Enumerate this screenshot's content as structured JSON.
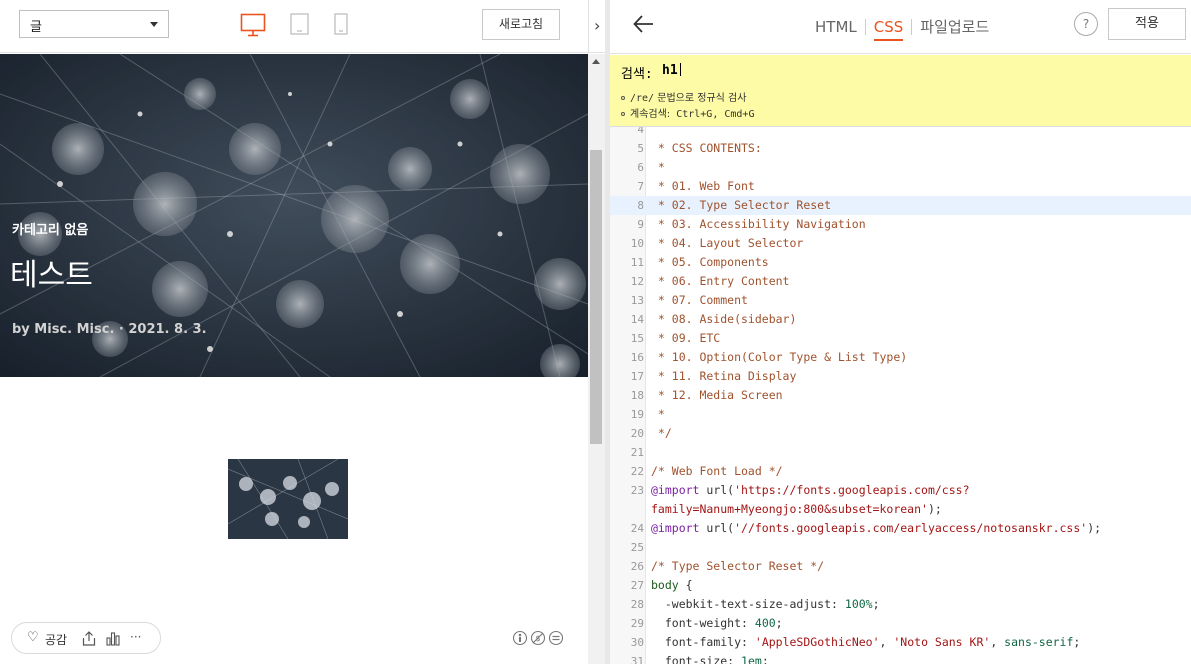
{
  "left": {
    "select_value": "글",
    "refresh_label": "새로고침",
    "hero": {
      "category": "카테고리 없음",
      "title": "테스트",
      "meta": "by Misc. Misc.  ·  2021. 8. 3."
    },
    "reaction": {
      "like_label": "공감",
      "more_label": "···"
    }
  },
  "editor": {
    "tabs": [
      {
        "label": "HTML",
        "active": false
      },
      {
        "label": "CSS",
        "active": true
      },
      {
        "label": "파일업로드",
        "active": false
      }
    ],
    "help_label": "?",
    "apply_label": "적용",
    "search": {
      "label": "검색:",
      "value": "h1",
      "hint1_a": "/re/",
      "hint1_b": " 문법으로 정규식 검사",
      "hint2_a": "계속검색:",
      "hint2_b": " Ctrl+G, Cmd+G"
    },
    "code_lines": [
      {
        "n": "4",
        "t": ""
      },
      {
        "n": "5",
        "t": " * CSS CONTENTS:",
        "cls": "c-com"
      },
      {
        "n": "6",
        "t": " *",
        "cls": "c-com"
      },
      {
        "n": "7",
        "t": " * 01. Web Font",
        "cls": "c-com"
      },
      {
        "n": "8",
        "t": " * 02. Type Selector Reset",
        "cls": "c-com",
        "hl": true
      },
      {
        "n": "9",
        "t": " * 03. Accessibility Navigation",
        "cls": "c-com"
      },
      {
        "n": "10",
        "t": " * 04. Layout Selector",
        "cls": "c-com"
      },
      {
        "n": "11",
        "t": " * 05. Components",
        "cls": "c-com"
      },
      {
        "n": "12",
        "t": " * 06. Entry Content",
        "cls": "c-com"
      },
      {
        "n": "13",
        "t": " * 07. Comment",
        "cls": "c-com"
      },
      {
        "n": "14",
        "t": " * 08. Aside(sidebar)",
        "cls": "c-com"
      },
      {
        "n": "15",
        "t": " * 09. ETC",
        "cls": "c-com"
      },
      {
        "n": "16",
        "t": " * 10. Option(Color Type & List Type)",
        "cls": "c-com"
      },
      {
        "n": "17",
        "t": " * 11. Retina Display",
        "cls": "c-com"
      },
      {
        "n": "18",
        "t": " * 12. Media Screen",
        "cls": "c-com"
      },
      {
        "n": "19",
        "t": " *",
        "cls": "c-com"
      },
      {
        "n": "20",
        "t": " */",
        "cls": "c-com"
      },
      {
        "n": "21",
        "t": ""
      },
      {
        "n": "22",
        "t": "/* Web Font Load */",
        "cls": "c-com"
      },
      {
        "n": "23",
        "t": "@import url('https://fonts.googleapis.com/css?",
        "cls": "import"
      },
      {
        "n": "",
        "t": "family=Nanum+Myeongjo:800&subset=korean');",
        "cls": "import-cont"
      },
      {
        "n": "24",
        "t": "@import url('//fonts.googleapis.com/earlyaccess/notosanskr.css');",
        "cls": "import"
      },
      {
        "n": "25",
        "t": ""
      },
      {
        "n": "26",
        "t": "/* Type Selector Reset */",
        "cls": "c-com"
      },
      {
        "n": "27",
        "t": "body {",
        "cls": "c-sel"
      },
      {
        "n": "28",
        "t": "  -webkit-text-size-adjust: 100%;",
        "cls": "prop"
      },
      {
        "n": "29",
        "t": "  font-weight: 400;",
        "cls": "prop"
      },
      {
        "n": "30",
        "t": "  font-family: 'AppleSDGothicNeo', 'Noto Sans KR', sans-serif;",
        "cls": "prop"
      },
      {
        "n": "31",
        "t": "  font-size: 1em;",
        "cls": "prop"
      }
    ]
  }
}
